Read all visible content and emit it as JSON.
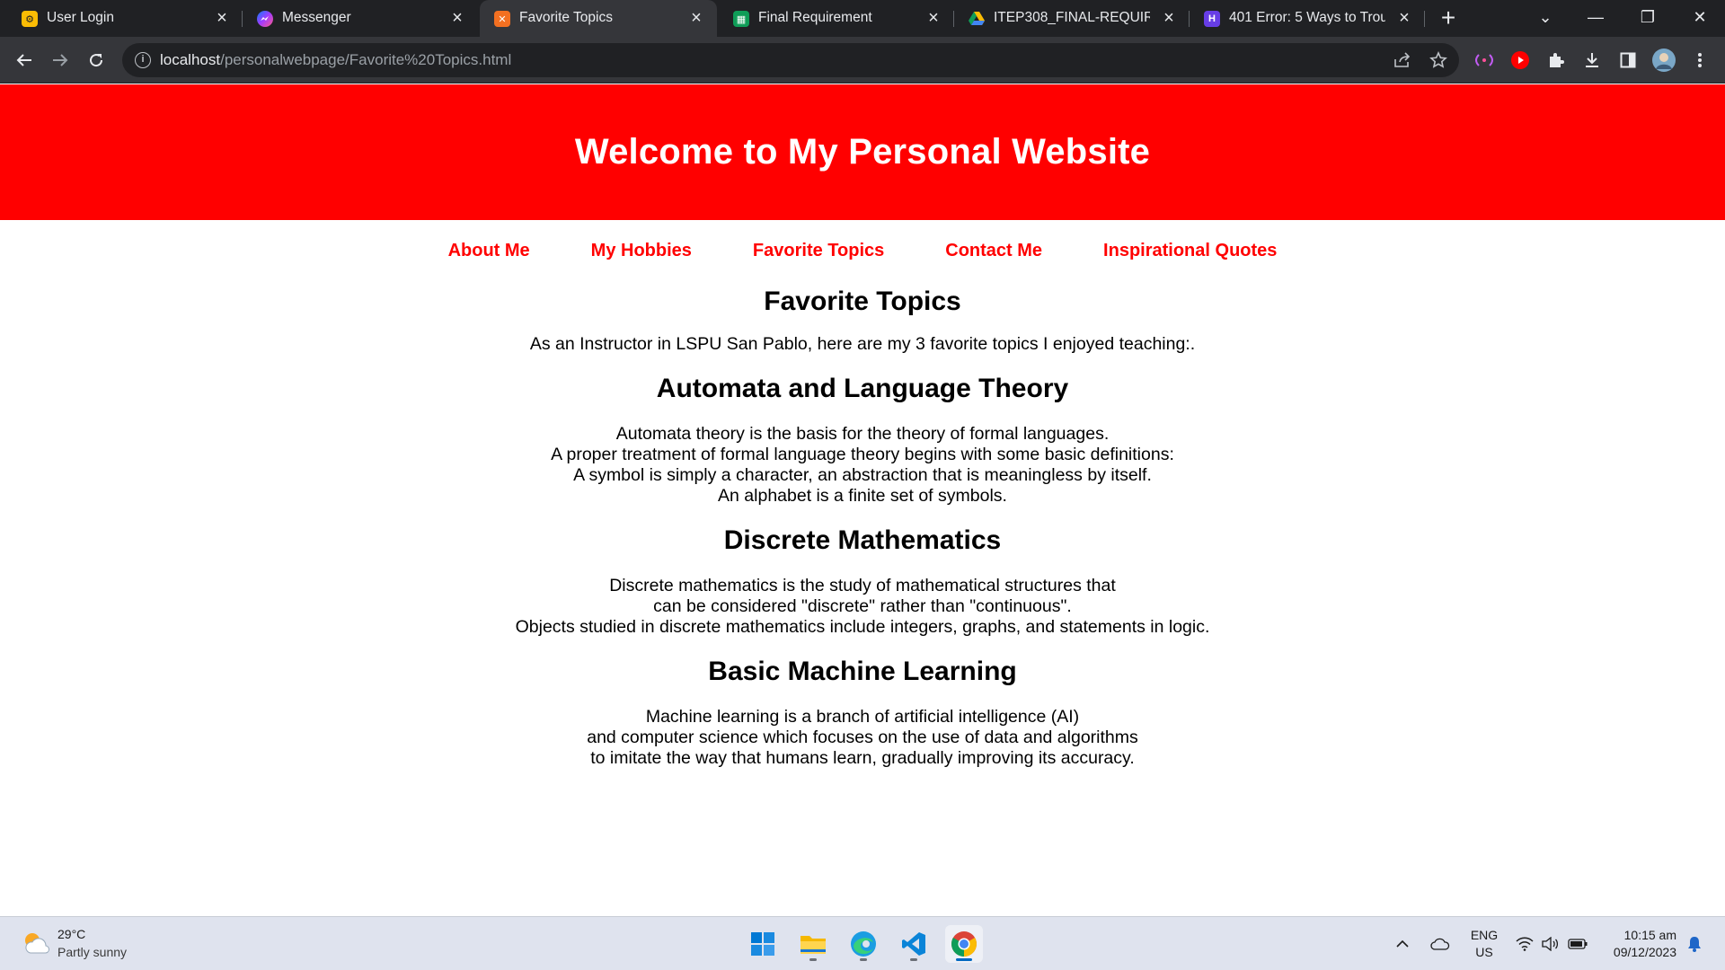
{
  "browser": {
    "tabs": [
      {
        "title": "User Login",
        "favicon": "xampp-icon",
        "favicon_color": "#fbbc04"
      },
      {
        "title": "Messenger",
        "favicon": "messenger-icon",
        "favicon_color": "#a33bff"
      },
      {
        "title": "Favorite Topics",
        "favicon": "xampp-icon",
        "favicon_color": "#f37021"
      },
      {
        "title": "Final Requirement",
        "favicon": "sheets-icon",
        "favicon_color": "#0f9d58"
      },
      {
        "title": "ITEP308_FINAL-REQUIREM",
        "favicon": "drive-icon",
        "favicon_color": "#fbbc04"
      },
      {
        "title": "401 Error: 5 Ways to Troub",
        "favicon": "hostinger-icon",
        "favicon_color": "#673de6"
      }
    ],
    "active_tab_index": 2,
    "url_host": "localhost",
    "url_path": "/personalwebpage/Favorite%20Topics.html"
  },
  "site": {
    "banner_title": "Welcome to My Personal Website",
    "nav": [
      "About Me",
      "My Hobbies",
      "Favorite Topics",
      "Contact Me",
      "Inspirational Quotes"
    ],
    "heading": "Favorite Topics",
    "intro": "As an Instructor in LSPU San Pablo, here are my 3 favorite topics I enjoyed teaching:.",
    "topics": [
      {
        "title": "Automata and Language Theory",
        "lines": [
          "Automata theory is the basis for the theory of formal languages.",
          "A proper treatment of formal language theory begins with some basic definitions:",
          "A symbol is simply a character, an abstraction that is meaningless by itself.",
          "An alphabet is a finite set of symbols."
        ]
      },
      {
        "title": "Discrete Mathematics",
        "lines": [
          "Discrete mathematics is the study of mathematical structures that",
          "can be considered \"discrete\" rather than \"continuous\".",
          "Objects studied in discrete mathematics include integers, graphs, and statements in logic."
        ]
      },
      {
        "title": "Basic Machine Learning",
        "lines": [
          "Machine learning is a branch of artificial intelligence (AI)",
          "and computer science which focuses on the use of data and algorithms",
          "to imitate the way that humans learn, gradually improving its accuracy."
        ]
      }
    ],
    "colors": {
      "banner": "#ff0000",
      "nav_link": "#ff0000"
    }
  },
  "taskbar": {
    "weather_temp": "29°C",
    "weather_condition": "Partly sunny",
    "apps": [
      "start-icon",
      "file-explorer-icon",
      "edge-icon",
      "vscode-icon",
      "chrome-icon"
    ],
    "language": "ENG",
    "region": "US",
    "time": "10:15 am",
    "date": "09/12/2023"
  }
}
